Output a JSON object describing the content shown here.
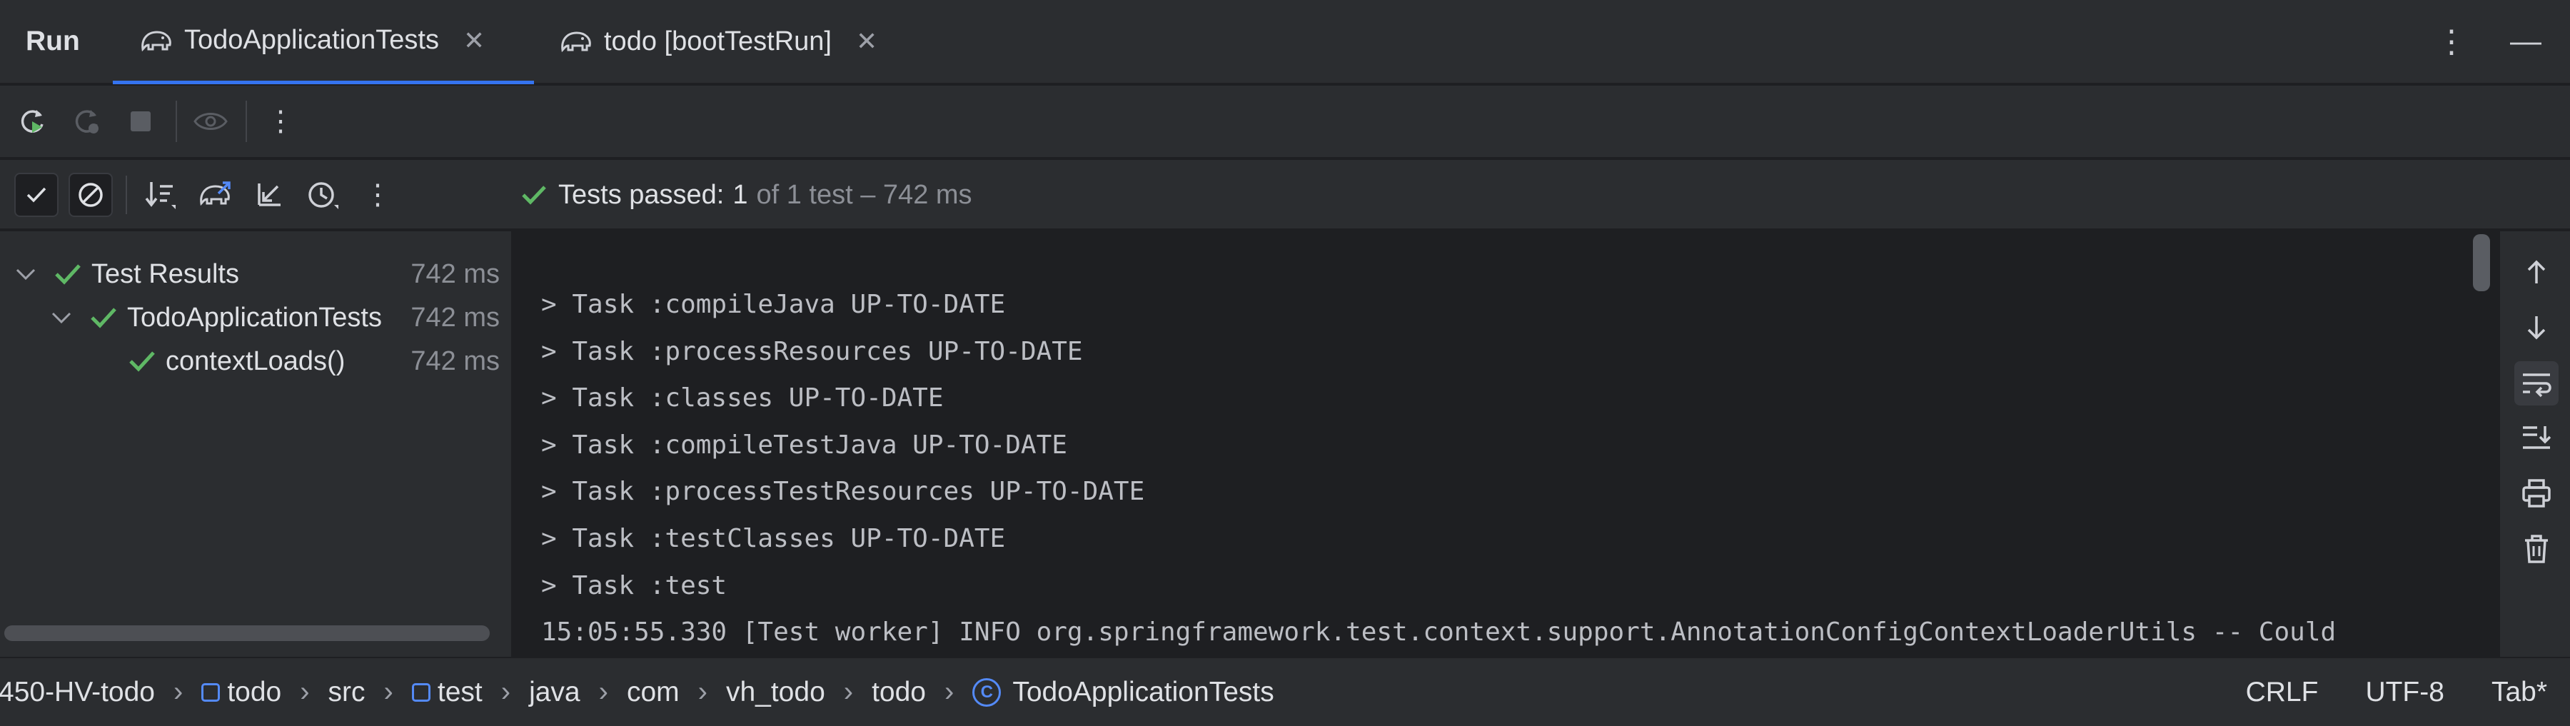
{
  "panel_title": "Run",
  "tabs": [
    {
      "label": "TodoApplicationTests",
      "active": true
    },
    {
      "label": "todo [bootTestRun]",
      "active": false
    }
  ],
  "status": {
    "prefix": "Tests passed:",
    "count": "1",
    "suffix": "of 1 test – 742 ms"
  },
  "tree": [
    {
      "label": "Test Results",
      "time": "742 ms",
      "level": 0
    },
    {
      "label": "TodoApplicationTests",
      "time": "742 ms",
      "level": 1
    },
    {
      "label": "contextLoads()",
      "time": "742 ms",
      "level": 2
    }
  ],
  "console_lines": [
    "> Task :compileJava UP-TO-DATE",
    "> Task :processResources UP-TO-DATE",
    "> Task :classes UP-TO-DATE",
    "> Task :compileTestJava UP-TO-DATE",
    "> Task :processTestResources UP-TO-DATE",
    "> Task :testClasses UP-TO-DATE",
    "> Task :test",
    "15:05:55.330 [Test worker] INFO org.springframework.test.context.support.AnnotationConfigContextLoaderUtils -- Could"
  ],
  "breadcrumbs": [
    "450-HV-todo",
    "todo",
    "src",
    "test",
    "java",
    "com",
    "vh_todo",
    "todo",
    "TodoApplicationTests"
  ],
  "statusbar_right": {
    "line_sep": "CRLF",
    "encoding": "UTF-8",
    "indent": "Tab*"
  },
  "colors": {
    "accent": "#3574f0",
    "pass": "#5fb865",
    "background": "#1e1f22",
    "panel": "#2b2d30"
  }
}
